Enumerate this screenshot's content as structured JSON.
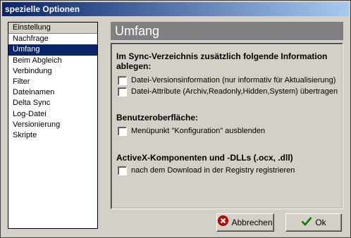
{
  "window": {
    "title": "spezielle Optionen"
  },
  "sidebar": {
    "items": [
      {
        "label": "Einstellung"
      },
      {
        "label": "Nachfrage"
      },
      {
        "label": "Umfang"
      },
      {
        "label": "Beim Abgleich"
      },
      {
        "label": "Verbindung"
      },
      {
        "label": "Filter"
      },
      {
        "label": "Dateinamen"
      },
      {
        "label": "Delta Sync"
      },
      {
        "label": "Log-Datei"
      },
      {
        "label": "Versionierung"
      },
      {
        "label": "Skripte"
      }
    ],
    "selected": "Umfang"
  },
  "panel": {
    "title": "Umfang",
    "section1": {
      "heading_line1": "Im Sync-Verzeichnis zusätzlich folgende Information",
      "heading_line2": "ablegen:",
      "options": [
        {
          "label": "Datei-Versionsinformation (nur informativ für Aktualisierung)",
          "checked": false
        },
        {
          "label": "Datei-Attribute (Archiv,Readonly,Hidden,System) übertragen",
          "checked": false
        }
      ]
    },
    "section2": {
      "heading": "Benutzeroberfläche:",
      "options": [
        {
          "label": "Menüpunkt \"Konfiguration\" ausblenden",
          "checked": false
        }
      ]
    },
    "section3": {
      "heading": "ActiveX-Komponenten und -DLLs (.ocx, .dll)",
      "options": [
        {
          "label": "nach dem Download in der Registry registrieren",
          "checked": false
        }
      ]
    }
  },
  "buttons": {
    "cancel": "Abbrechen",
    "ok": "Ok"
  }
}
